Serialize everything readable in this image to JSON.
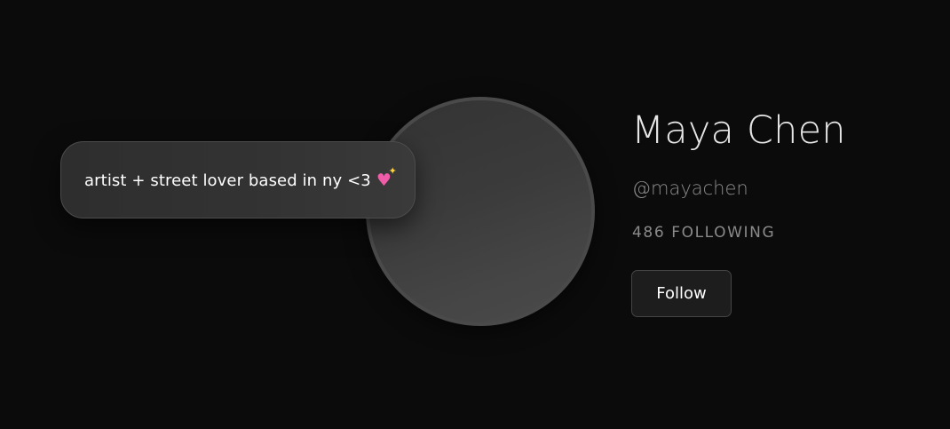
{
  "profile": {
    "bio": "artist + street lover based in ny <3",
    "bio_emoji": "sparkling-heart",
    "name": "Maya Chen",
    "handle": "@mayachen",
    "following_label": "486 FOLLOWING",
    "follow_button_label": "Follow"
  },
  "colors": {
    "background": "#0b0b0b",
    "heart_emoji": "#f05ca8",
    "sparkle": "#ffd23f"
  }
}
